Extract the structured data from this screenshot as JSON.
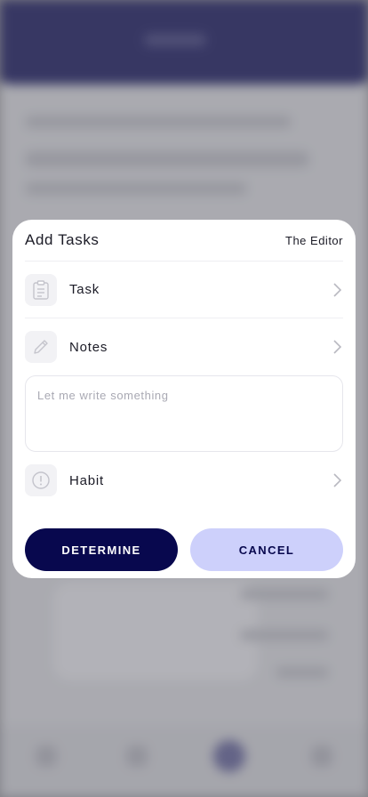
{
  "modal": {
    "title": "Add Tasks",
    "editor_link": "The Editor",
    "rows": [
      {
        "label": "Task",
        "icon": "clipboard-icon"
      },
      {
        "label": "Notes",
        "icon": "pencil-icon"
      },
      {
        "label": "Habit",
        "icon": "alert-circle-icon"
      }
    ],
    "notes": {
      "value": "",
      "placeholder": "Let me write something"
    },
    "buttons": {
      "determine": "DETERMINE",
      "cancel": "CANCEL"
    }
  },
  "colors": {
    "primary": "#08084e",
    "secondary": "#cdd0fb",
    "header": "#0a0a55",
    "text": "#1b1b26",
    "placeholder": "#a9a9b3"
  }
}
